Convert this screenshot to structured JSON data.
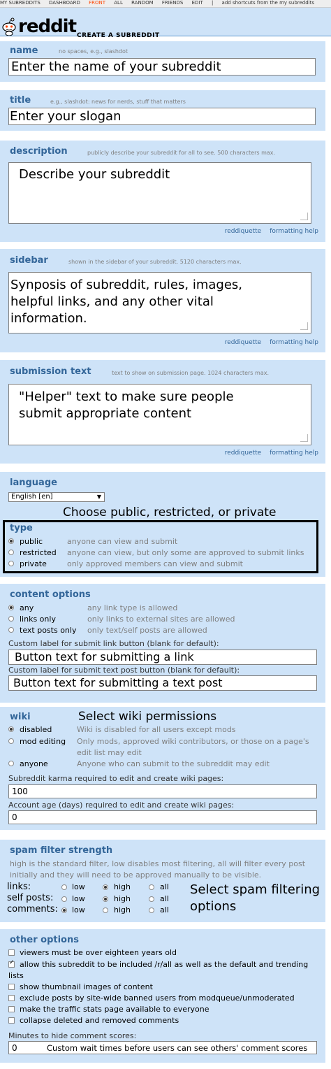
{
  "topbar": {
    "items": [
      "MY SUBREDDITS",
      "DASHBOARD",
      "FRONT",
      "ALL",
      "RANDOM",
      "FRIENDS",
      "EDIT",
      "|",
      "add shortcuts from the my subreddits"
    ]
  },
  "header": {
    "logo": "reddit",
    "page_name": "CREATE A SUBREDDIT"
  },
  "name_section": {
    "title": "name",
    "hint": "no spaces, e.g., slashdot",
    "value": "Enter the name of your subreddit"
  },
  "title_section": {
    "title": "title",
    "hint": "e.g., slashdot: news for nerds, stuff that matters",
    "value": "Enter your slogan"
  },
  "description_section": {
    "title": "description",
    "hint": "publicly describe your subreddit for all to see. 500 characters max.",
    "value": "Describe your subreddit",
    "link_reddiquette": "reddiquette",
    "link_formatting": "formatting help"
  },
  "sidebar_section": {
    "title": "sidebar",
    "hint": "shown in the sidebar of your subreddit. 5120 characters max.",
    "line1": "Synposis of subreddit, rules, images,",
    "line2": "helpful links, and any other vital",
    "line3": "information.",
    "link_reddiquette": "reddiquette",
    "link_formatting": "formatting help"
  },
  "submission_section": {
    "title": "submission text",
    "hint": "text to show on submission page. 1024 characters max.",
    "line1": "\"Helper\" text to make sure people",
    "line2": "submit appropriate content",
    "link_reddiquette": "reddiquette",
    "link_formatting": "formatting help"
  },
  "language_section": {
    "title": "language",
    "selected": "English [en]"
  },
  "type_section": {
    "annotation": "Choose public, restricted, or private",
    "title": "type",
    "options": [
      {
        "label": "public",
        "desc": "anyone can view and submit",
        "selected": true
      },
      {
        "label": "restricted",
        "desc": "anyone can view, but only some are approved to submit links",
        "selected": false
      },
      {
        "label": "private",
        "desc": "only approved members can view and submit",
        "selected": false
      }
    ]
  },
  "content_section": {
    "title": "content options",
    "options": [
      {
        "label": "any",
        "desc": "any link type is allowed",
        "selected": true
      },
      {
        "label": "links only",
        "desc": "only links to external sites are allowed",
        "selected": false
      },
      {
        "label": "text posts only",
        "desc": "only text/self posts are allowed",
        "selected": false
      }
    ],
    "link_label": "Custom label for submit link button (blank for default):",
    "link_value": "Button text for submitting a link",
    "text_label": "Custom label for submit text post button (blank for default):",
    "text_value": "Button text for submitting a text post"
  },
  "wiki_section": {
    "title": "wiki",
    "annotation": "Select wiki permissions",
    "options": [
      {
        "label": "disabled",
        "desc": "Wiki is disabled for all users except mods",
        "selected": true
      },
      {
        "label": "mod editing",
        "desc": "Only mods, approved wiki contributors, or those on a page's",
        "desc2": "edit list may edit",
        "selected": false
      },
      {
        "label": "anyone",
        "desc": "Anyone who can submit to the subreddit may edit",
        "selected": false
      }
    ],
    "karma_label": "Subreddit karma required to edit and create wiki pages:",
    "karma_value": "100",
    "age_label": "Account age (days) required to edit and create wiki pages:",
    "age_value": "0"
  },
  "spam_section": {
    "title": "spam filter strength",
    "desc1": "high is the standard filter, low disables most filtering, all will filter every post",
    "desc2": "initially and they will need to be approved manually to be visible.",
    "annotation1": "Select spam filtering",
    "annotation2": "options",
    "rows": [
      {
        "label": "links:",
        "selected": "high"
      },
      {
        "label": "self posts:",
        "selected": "high"
      },
      {
        "label": "comments:",
        "selected": "low"
      }
    ],
    "levels": [
      "low",
      "high",
      "all"
    ]
  },
  "other_section": {
    "title": "other options",
    "options": [
      {
        "label": "viewers must be over eighteen years old",
        "checked": false
      },
      {
        "label": "allow this subreddit to be included /r/all as well as the default and trending",
        "label2": "lists",
        "checked": true
      },
      {
        "label": "show thumbnail images of content",
        "checked": false
      },
      {
        "label": "exclude posts by site-wide banned users from modqueue/unmoderated",
        "checked": false
      },
      {
        "label": "make the traffic stats page available to everyone",
        "checked": false
      },
      {
        "label": "collapse deleted and removed comments",
        "checked": false
      }
    ],
    "minutes_label": "Minutes to hide comment scores:",
    "minutes_value": "0",
    "annotation": "Custom wait times before users can see others' comment scores"
  }
}
